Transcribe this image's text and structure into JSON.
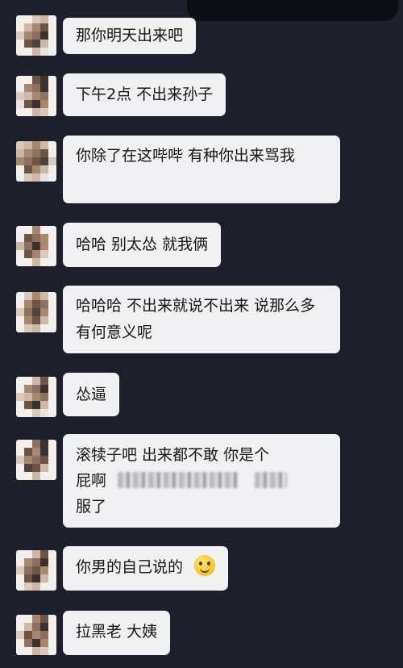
{
  "messages": [
    {
      "text": "那你明天出来吧"
    },
    {
      "text": "下午2点  不出来孙子"
    },
    {
      "text": "你除了在这哔哔  有种你出来骂我"
    },
    {
      "text": "哈哈   别太怂   就我俩"
    },
    {
      "text": "哈哈哈   不出来就说不出来  说那么多有何意义呢"
    },
    {
      "text": "怂逼"
    },
    {
      "text_line1": "滚犊子吧   出来都不敢   你是个",
      "text_line2": "屁啊",
      "text_line3": "服了"
    },
    {
      "text": "你男的自己说的",
      "emoji": "smiling-face-emoji"
    },
    {
      "text": "拉黑老  大姨"
    }
  ]
}
